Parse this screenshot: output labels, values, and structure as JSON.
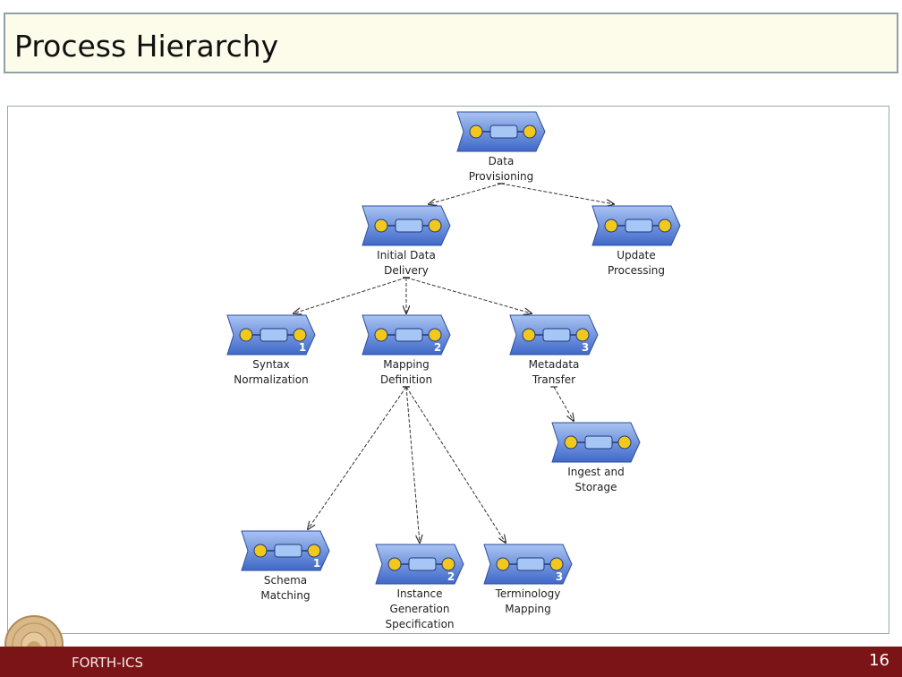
{
  "slide": {
    "title": "Process Hierarchy",
    "footer_org": "FORTH-ICS",
    "page_number": "16"
  },
  "diagram": {
    "nodes": [
      {
        "id": "data-provisioning",
        "label_lines": [
          "Data",
          "Provisioning"
        ],
        "number": ""
      },
      {
        "id": "initial-data-delivery",
        "label_lines": [
          "Initial Data",
          "Delivery"
        ],
        "number": ""
      },
      {
        "id": "update-processing",
        "label_lines": [
          "Update",
          "Processing"
        ],
        "number": ""
      },
      {
        "id": "syntax-normalization",
        "label_lines": [
          "Syntax",
          "Normalization"
        ],
        "number": "1"
      },
      {
        "id": "mapping-definition",
        "label_lines": [
          "Mapping",
          "Definition"
        ],
        "number": "2"
      },
      {
        "id": "metadata-transfer",
        "label_lines": [
          "Metadata",
          "Transfer"
        ],
        "number": "3"
      },
      {
        "id": "ingest-and-storage",
        "label_lines": [
          "Ingest and",
          "Storage"
        ],
        "number": ""
      },
      {
        "id": "schema-matching",
        "label_lines": [
          "Schema",
          "Matching"
        ],
        "number": "1"
      },
      {
        "id": "instance-generation-specification",
        "label_lines": [
          "Instance",
          "Generation",
          "Specification"
        ],
        "number": "2"
      },
      {
        "id": "terminology-mapping",
        "label_lines": [
          "Terminology",
          "Mapping"
        ],
        "number": "3"
      }
    ],
    "edges": [
      {
        "from": "data-provisioning",
        "to": "initial-data-delivery"
      },
      {
        "from": "data-provisioning",
        "to": "update-processing"
      },
      {
        "from": "initial-data-delivery",
        "to": "syntax-normalization"
      },
      {
        "from": "initial-data-delivery",
        "to": "mapping-definition"
      },
      {
        "from": "initial-data-delivery",
        "to": "metadata-transfer"
      },
      {
        "from": "metadata-transfer",
        "to": "ingest-and-storage"
      },
      {
        "from": "mapping-definition",
        "to": "schema-matching"
      },
      {
        "from": "mapping-definition",
        "to": "instance-generation-specification"
      },
      {
        "from": "mapping-definition",
        "to": "terminology-mapping"
      }
    ],
    "colors": {
      "node_fill_top": "#a9c3f2",
      "node_fill_bottom": "#3f68c9",
      "node_stroke": "#2c4f9e",
      "token_fill": "#f2c81c",
      "task_fill": "#a6c6f5",
      "edge": "#333333"
    }
  }
}
